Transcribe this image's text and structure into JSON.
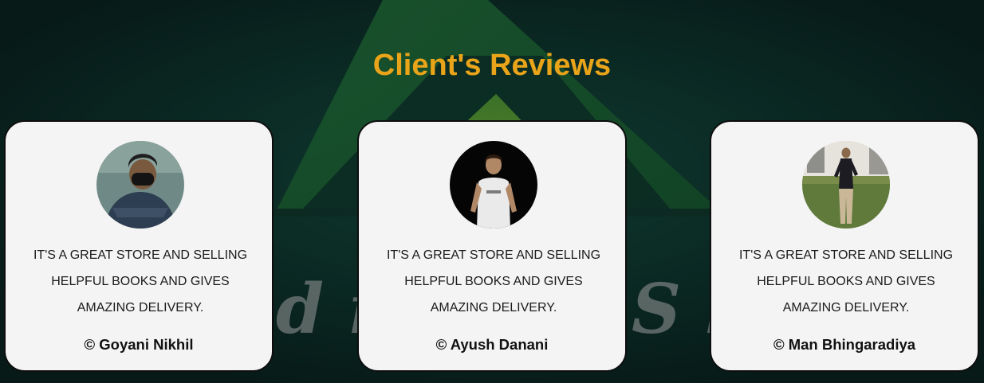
{
  "section": {
    "title": "Client's Reviews"
  },
  "reviews": [
    {
      "quote": "IT'S A GREAT STORE AND SELLING HELPFUL BOOKS AND GIVES AMAZING DELIVERY.",
      "author": "© Goyani Nikhil"
    },
    {
      "quote": "IT'S A GREAT STORE AND SELLING HELPFUL BOOKS AND GIVES AMAZING DELIVERY.",
      "author": "© Ayush Danani"
    },
    {
      "quote": "IT'S A GREAT STORE AND SELLING HELPFUL BOOKS AND GIVES AMAZING DELIVERY.",
      "author": "© Man Bhingaradiya"
    }
  ],
  "colors": {
    "background": "#0a201e",
    "title": "#e9a419",
    "card": "#f4f4f4",
    "logo_green": "#1d5a2e",
    "logo_light_green": "#4e7a2a"
  },
  "icons": [
    "background-logo-icon"
  ]
}
